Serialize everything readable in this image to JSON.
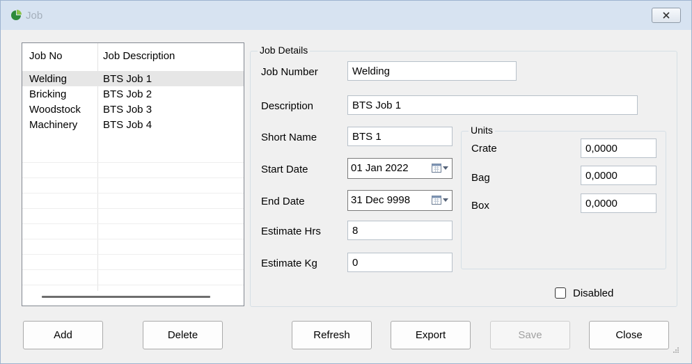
{
  "window": {
    "title": "Job"
  },
  "grid": {
    "columns": [
      "Job No",
      "Job Description"
    ],
    "rows": [
      {
        "job_no": "Welding",
        "description": "BTS Job 1"
      },
      {
        "job_no": "Bricking",
        "description": "BTS Job 2"
      },
      {
        "job_no": "Woodstock",
        "description": "BTS Job 3"
      },
      {
        "job_no": "Machinery",
        "description": "BTS Job 4"
      }
    ]
  },
  "details": {
    "legend": "Job Details",
    "job_number_label": "Job Number",
    "job_number": "Welding",
    "description_label": "Description",
    "description": "BTS Job 1",
    "short_name_label": "Short Name",
    "short_name": "BTS 1",
    "start_date_label": "Start Date",
    "start_date": "01 Jan  2022",
    "end_date_label": "End Date",
    "end_date": "31 Dec 9998",
    "estimate_hrs_label": "Estimate Hrs",
    "estimate_hrs": "8",
    "estimate_kg_label": "Estimate Kg",
    "estimate_kg": "0",
    "disabled_label": "Disabled",
    "disabled": false
  },
  "units": {
    "legend": "Units",
    "crate_label": "Crate",
    "crate": "0,0000",
    "bag_label": "Bag",
    "bag": "0,0000",
    "box_label": "Box",
    "box": "0,0000"
  },
  "buttons": {
    "add": "Add",
    "delete": "Delete",
    "refresh": "Refresh",
    "export": "Export",
    "save": "Save",
    "close": "Close"
  },
  "colors": {
    "accent": "#4caf50",
    "titlebar": "#d7e3f1",
    "selection": "#e6e6e6"
  },
  "icons": {
    "app": "pie-chart-icon",
    "close": "close-icon",
    "calendar": "calendar-icon",
    "grip": "resize-grip-icon"
  }
}
